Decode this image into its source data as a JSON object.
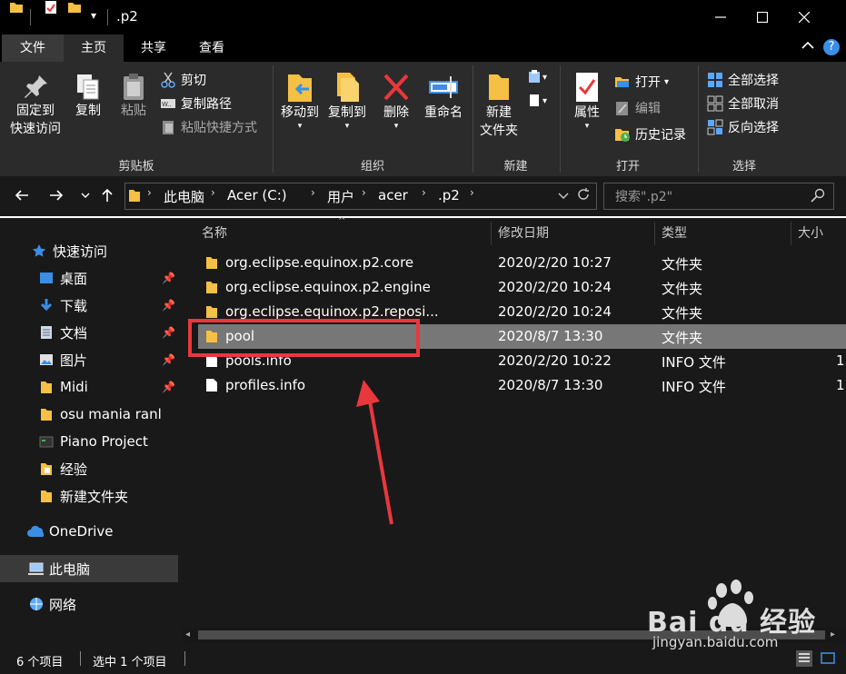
{
  "window": {
    "title": ".p2",
    "qat_dropdown": "▾"
  },
  "tabs": {
    "file": "文件",
    "home": "主页",
    "share": "共享",
    "view": "查看"
  },
  "ribbon": {
    "clipboard": {
      "pin_quick_access": [
        "固定到",
        "快速访问"
      ],
      "copy": "复制",
      "paste": "粘贴",
      "cut": "剪切",
      "copy_path": "复制路径",
      "paste_shortcut": "粘贴快捷方式",
      "label": "剪贴板"
    },
    "organize": {
      "move_to": "移动到",
      "copy_to": "复制到",
      "delete": "删除",
      "rename": "重命名",
      "label": "组织"
    },
    "new": {
      "new_folder": [
        "新建",
        "文件夹"
      ],
      "label": "新建"
    },
    "open": {
      "properties": "属性",
      "open": "打开",
      "edit": "编辑",
      "history": "历史记录",
      "label": "打开"
    },
    "select": {
      "select_all": "全部选择",
      "select_none": "全部取消",
      "invert": "反向选择",
      "label": "选择"
    }
  },
  "address": {
    "crumbs": [
      "此电脑",
      "Acer (C:)",
      "用户",
      "acer",
      ".p2"
    ],
    "search_placeholder": "搜索\".p2\""
  },
  "nav": {
    "quick_access": "快速访问",
    "items": [
      "桌面",
      "下载",
      "文档",
      "图片",
      "Midi",
      "osu mania ranl",
      "Piano Project",
      "经验",
      "新建文件夹"
    ],
    "onedrive": "OneDrive",
    "this_pc": "此电脑",
    "network": "网络"
  },
  "columns": {
    "name": "名称",
    "date": "修改日期",
    "type": "类型",
    "size": "大小"
  },
  "files": [
    {
      "name": "org.eclipse.equinox.p2.core",
      "date": "2020/2/20 10:27",
      "type": "文件夹",
      "size": ""
    },
    {
      "name": "org.eclipse.equinox.p2.engine",
      "date": "2020/2/20 10:24",
      "type": "文件夹",
      "size": ""
    },
    {
      "name": "org.eclipse.equinox.p2.reposi...",
      "date": "2020/2/20 10:24",
      "type": "文件夹",
      "size": ""
    },
    {
      "name": "pool",
      "date": "2020/8/7 13:30",
      "type": "文件夹",
      "size": ""
    },
    {
      "name": "pools.info",
      "date": "2020/2/20 10:22",
      "type": "INFO 文件",
      "size": "1"
    },
    {
      "name": "profiles.info",
      "date": "2020/8/7 13:30",
      "type": "INFO 文件",
      "size": "1"
    }
  ],
  "status": {
    "count": "6 个项目",
    "selected": "选中 1 个项目"
  },
  "watermark": {
    "brand": "Bai du 经验",
    "url": "jingyan.baidu.com"
  },
  "colors": {
    "highlight": "#e8383d",
    "folder": "#f5c043",
    "accent_blue": "#3a8ee6"
  }
}
